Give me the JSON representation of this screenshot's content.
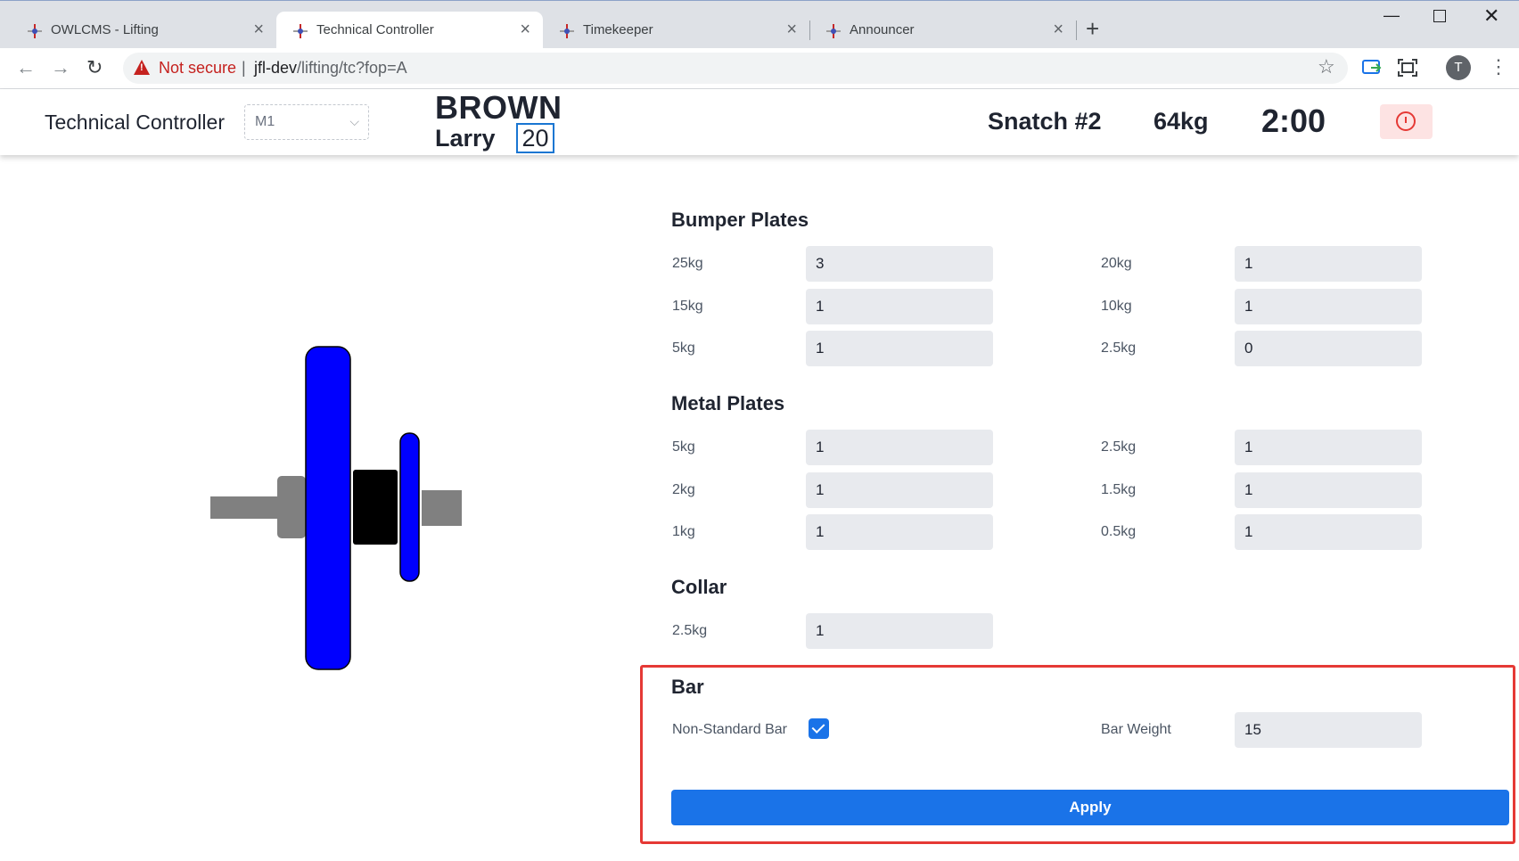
{
  "browser": {
    "tabs": [
      {
        "title": "OWLCMS - Lifting",
        "active": false
      },
      {
        "title": "Technical Controller",
        "active": true
      },
      {
        "title": "Timekeeper",
        "active": false
      },
      {
        "title": "Announcer",
        "active": false
      }
    ],
    "address": {
      "security_label": "Not secure",
      "separator": "|",
      "host": "jfl-dev",
      "path": "/lifting/tc?fop=A"
    },
    "profile_initial": "T"
  },
  "header": {
    "title": "Technical Controller",
    "platform": "M1",
    "athlete_last_name": "BROWN",
    "athlete_first_name": "Larry",
    "start_number": "20",
    "attempt": "Snatch #2",
    "requested_weight": "64kg",
    "clock": "2:00"
  },
  "bumper": {
    "title": "Bumper Plates",
    "plates": [
      {
        "label": "25kg",
        "value": "3"
      },
      {
        "label": "20kg",
        "value": "1"
      },
      {
        "label": "15kg",
        "value": "1"
      },
      {
        "label": "10kg",
        "value": "1"
      },
      {
        "label": "5kg",
        "value": "1"
      },
      {
        "label": "2.5kg",
        "value": "0"
      }
    ]
  },
  "metal": {
    "title": "Metal Plates",
    "plates": [
      {
        "label": "5kg",
        "value": "1"
      },
      {
        "label": "2.5kg",
        "value": "1"
      },
      {
        "label": "2kg",
        "value": "1"
      },
      {
        "label": "1.5kg",
        "value": "1"
      },
      {
        "label": "1kg",
        "value": "1"
      },
      {
        "label": "0.5kg",
        "value": "1"
      }
    ]
  },
  "collar": {
    "title": "Collar",
    "label": "2.5kg",
    "value": "1"
  },
  "bar": {
    "title": "Bar",
    "nonstandard_label": "Non-Standard Bar",
    "nonstandard_checked": true,
    "weight_label": "Bar Weight",
    "weight_value": "15"
  },
  "apply_label": "Apply",
  "colors": {
    "accent": "#1a73e8",
    "plate_blue": "#0000ff",
    "highlight": "#e53935"
  }
}
